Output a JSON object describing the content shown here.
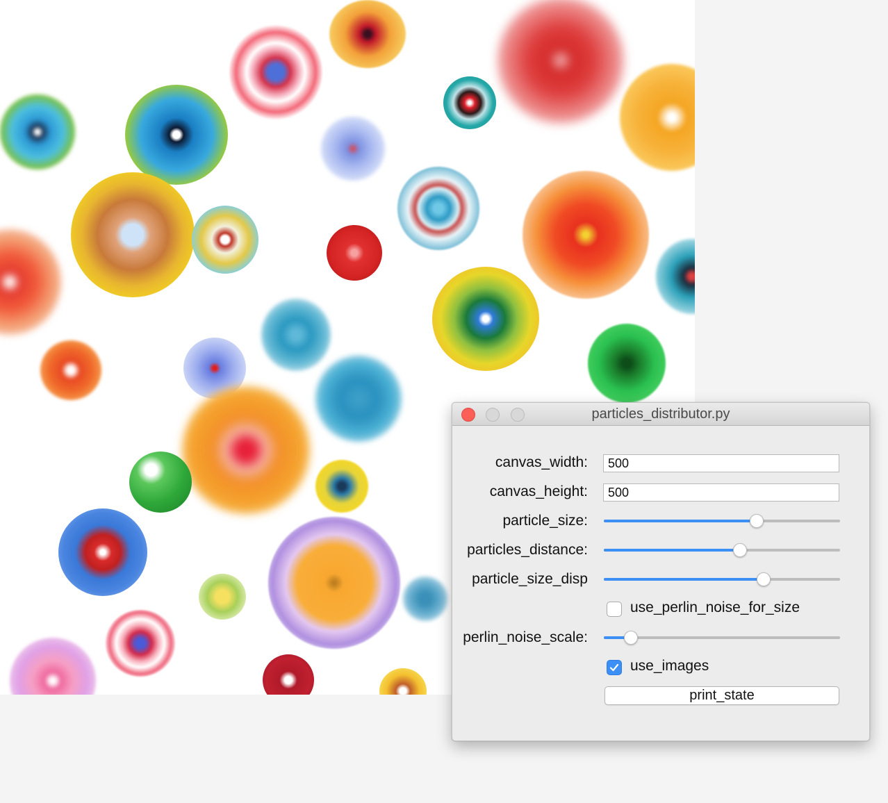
{
  "window": {
    "title": "particles_distributor.py"
  },
  "controls": {
    "canvas_width": {
      "label": "canvas_width:",
      "value": "500"
    },
    "canvas_height": {
      "label": "canvas_height:",
      "value": "500"
    },
    "particle_size": {
      "label": "particle_size:",
      "fraction": 0.647
    },
    "particles_distance": {
      "label": "particles_distance:",
      "fraction": 0.576
    },
    "particle_size_disp": {
      "label": "particle_size_disp",
      "fraction": 0.676
    },
    "use_perlin_noise_for_size": {
      "label": "use_perlin_noise_for_size",
      "checked": false
    },
    "perlin_noise_scale": {
      "label": "perlin_noise_scale:",
      "fraction": 0.115
    },
    "use_images": {
      "label": "use_images",
      "checked": true
    },
    "print_state": {
      "label": "print_state"
    }
  },
  "colors": {
    "accent": "#3b8ff5",
    "close_button": "#fc5f57",
    "window_background": "#ececec"
  }
}
